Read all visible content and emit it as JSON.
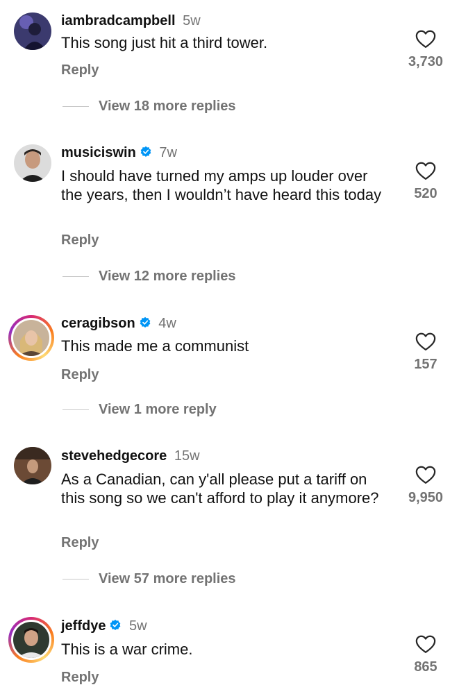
{
  "comments": [
    {
      "username": "iambradcampbell",
      "time": "5w",
      "verified": false,
      "text": "This song just hit a third tower.",
      "reply": "Reply",
      "likes": "3,730",
      "view_replies": "View 18 more replies"
    },
    {
      "username": "musiciswin",
      "time": "7w",
      "verified": true,
      "text": "I should have turned my amps up louder over the years, then I wouldn’t have heard this today",
      "reply": "Reply",
      "likes": "520",
      "view_replies": "View 12 more replies"
    },
    {
      "username": "ceragibson",
      "time": "4w",
      "verified": true,
      "text": "This made me a communist",
      "reply": "Reply",
      "likes": "157",
      "view_replies": "View 1 more reply"
    },
    {
      "username": "stevehedgecore",
      "time": "15w",
      "verified": false,
      "text": "As a Canadian, can y'all please put a tariff on this song so we can't afford to play it anymore?",
      "reply": "Reply",
      "likes": "9,950",
      "view_replies": "View 57 more replies"
    },
    {
      "username": "jeffdye",
      "time": "5w",
      "verified": true,
      "text": "This is a war crime.",
      "reply": "Reply",
      "likes": "865"
    }
  ],
  "colors": {
    "verified_blue": "#0095f6",
    "secondary_text": "#737373"
  }
}
